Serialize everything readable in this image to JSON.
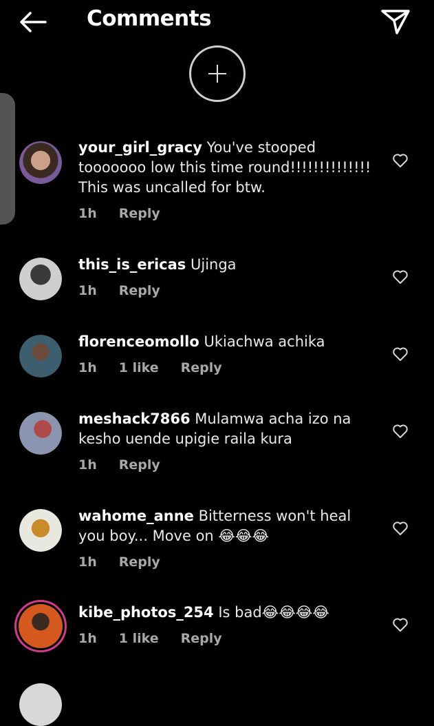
{
  "header": {
    "title": "Comments"
  },
  "comments": [
    {
      "user": "your_girl_gracy",
      "text": " You've stooped tooooooo low this time round!!!!!!!!!!!!!! This was uncalled for btw.",
      "time": "1h",
      "likes": "",
      "reply": "Reply"
    },
    {
      "user": "this_is_ericas",
      "text": " Ujinga",
      "time": "1h",
      "likes": "",
      "reply": "Reply"
    },
    {
      "user": "florenceomollo",
      "text": " Ukiachwa achika",
      "time": "1h",
      "likes": "1 like",
      "reply": "Reply"
    },
    {
      "user": "meshack7866",
      "text": " Mulamwa acha izo na kesho uende upigie raila kura",
      "time": "1h",
      "likes": "",
      "reply": "Reply"
    },
    {
      "user": "wahome_anne",
      "text": " Bitterness won't heal you boy... Move on 😂😂😂",
      "time": "1h",
      "likes": "",
      "reply": "Reply"
    },
    {
      "user": "kibe_photos_254",
      "text": " Is bad😂😂😂😂",
      "time": "1h",
      "likes": "1 like",
      "reply": "Reply"
    }
  ],
  "colors": {
    "background": "#000000",
    "text": "#ffffff",
    "meta": "#a8a8a8",
    "story_ring": "#d43a8a"
  },
  "icons": {
    "back": "arrow-left-icon",
    "share": "paper-plane-icon",
    "add": "plus-circle-icon",
    "like": "heart-outline-icon"
  }
}
